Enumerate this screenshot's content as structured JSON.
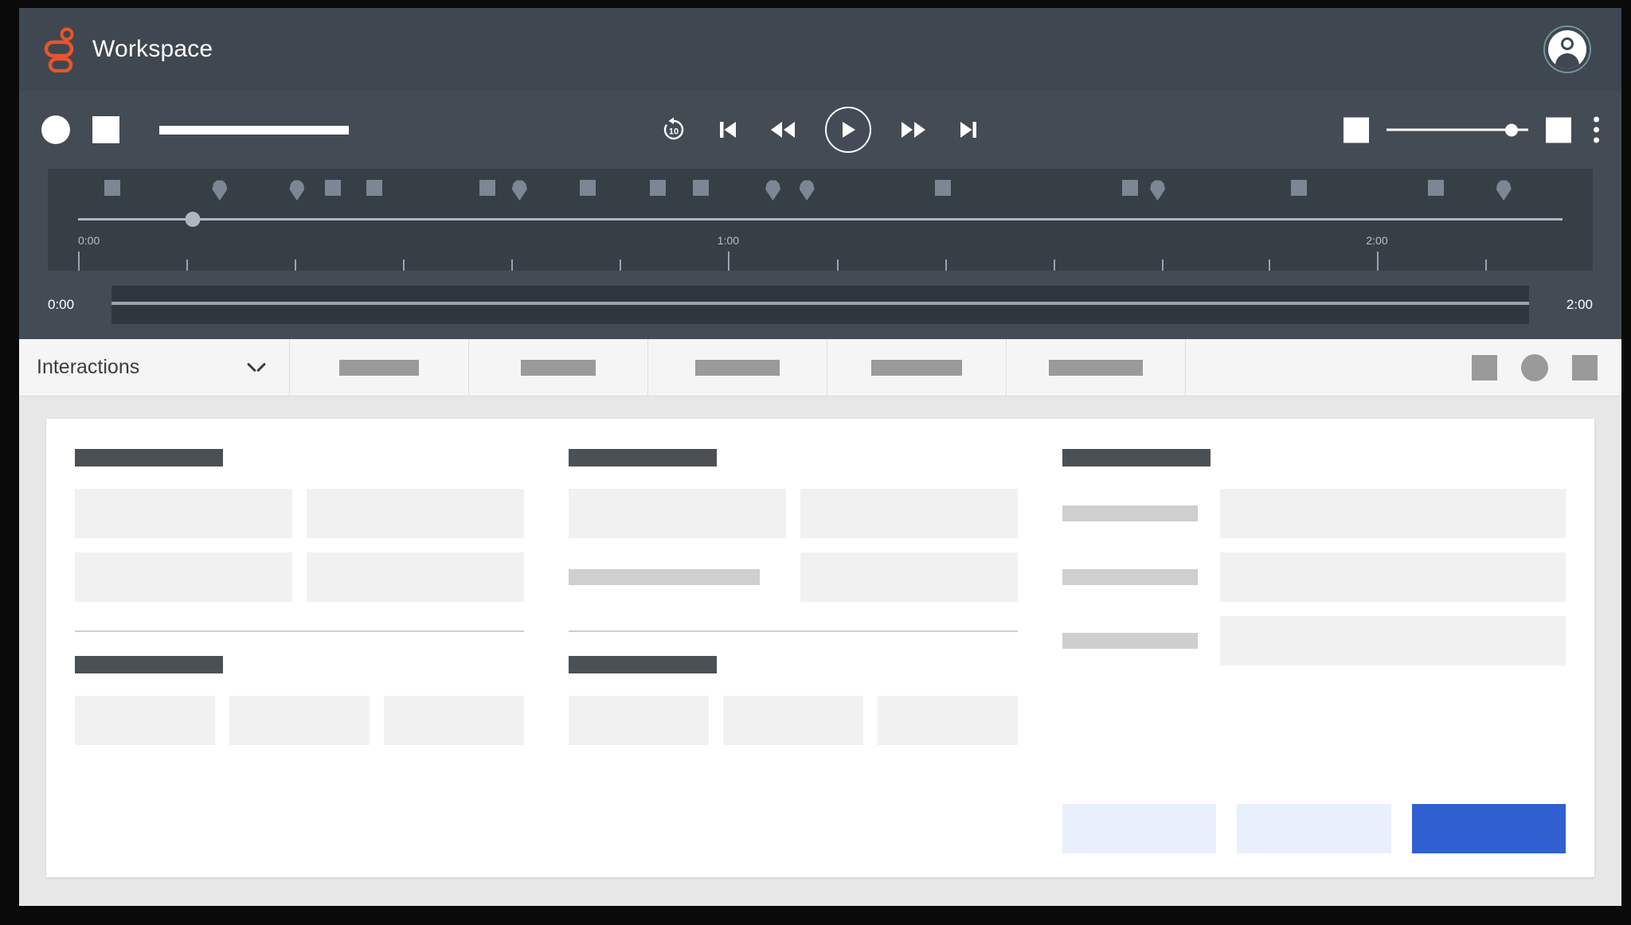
{
  "window": {
    "frame_color": "#0a0a0a",
    "background": "#e7e7e7"
  },
  "header": {
    "title": "Workspace",
    "background": "#3f4750",
    "logo": {
      "icon": "workspace-logo-icon",
      "color": "#e8552c"
    },
    "avatar": {
      "icon": "user-avatar-icon",
      "ring_color": "#6f93a0"
    }
  },
  "player": {
    "background": "#434c55",
    "left_controls": [
      {
        "icon": "record-circle-placeholder",
        "shape": "circle"
      },
      {
        "icon": "stop-square-placeholder",
        "shape": "square"
      },
      {
        "icon": "title-bar-placeholder",
        "shape": "bar"
      }
    ],
    "transport": [
      {
        "icon": "replay-10-icon",
        "label": "10"
      },
      {
        "icon": "skip-previous-icon",
        "label": ""
      },
      {
        "icon": "rewind-icon",
        "label": ""
      },
      {
        "icon": "play-icon",
        "label": ""
      },
      {
        "icon": "fast-forward-icon",
        "label": ""
      },
      {
        "icon": "skip-next-icon",
        "label": ""
      }
    ],
    "right_controls": {
      "mute_icon": "volume-square-placeholder",
      "volume_percent": 88,
      "fullscreen_icon": "fullscreen-square-placeholder",
      "overflow_icon": "kebab-menu-icon"
    }
  },
  "timeline": {
    "background": "#363e46",
    "playhead_percent": 7.4,
    "marker_color": "#7b8794",
    "markers": [
      {
        "type": "square",
        "percent": 2.2
      },
      {
        "type": "pin",
        "percent": 9.2
      },
      {
        "type": "pin",
        "percent": 14.2
      },
      {
        "type": "square",
        "percent": 16.5
      },
      {
        "type": "square",
        "percent": 19.2
      },
      {
        "type": "square",
        "percent": 26.5
      },
      {
        "type": "pin",
        "percent": 28.6
      },
      {
        "type": "square",
        "percent": 33.0
      },
      {
        "type": "square",
        "percent": 37.5
      },
      {
        "type": "square",
        "percent": 40.3
      },
      {
        "type": "pin",
        "percent": 45.0
      },
      {
        "type": "pin",
        "percent": 47.2
      },
      {
        "type": "square",
        "percent": 56.0
      },
      {
        "type": "square",
        "percent": 68.1
      },
      {
        "type": "pin",
        "percent": 69.9
      },
      {
        "type": "square",
        "percent": 79.0
      },
      {
        "type": "square",
        "percent": 87.9
      },
      {
        "type": "pin",
        "percent": 92.3
      }
    ],
    "ruler_labels": [
      {
        "text": "0:00",
        "percent": 0
      },
      {
        "text": "1:00",
        "percent": 43.8
      },
      {
        "text": "2:00",
        "percent": 87.5
      }
    ],
    "ticks": [
      {
        "percent": 0,
        "major": true
      },
      {
        "percent": 7.3,
        "major": false
      },
      {
        "percent": 14.6,
        "major": false
      },
      {
        "percent": 21.9,
        "major": false
      },
      {
        "percent": 29.2,
        "major": false
      },
      {
        "percent": 36.5,
        "major": false
      },
      {
        "percent": 43.8,
        "major": true
      },
      {
        "percent": 51.1,
        "major": false
      },
      {
        "percent": 58.4,
        "major": false
      },
      {
        "percent": 65.7,
        "major": false
      },
      {
        "percent": 73.0,
        "major": false
      },
      {
        "percent": 80.2,
        "major": false
      },
      {
        "percent": 87.5,
        "major": true
      },
      {
        "percent": 94.8,
        "major": false
      }
    ]
  },
  "waveform": {
    "start_time": "0:00",
    "end_time": "2:00",
    "track_color": "#2f363e",
    "line_color": "#9aa4ae"
  },
  "tabbar": {
    "background": "#f5f5f5",
    "selector": {
      "label": "Interactions",
      "icon": "chevron-down-icon"
    },
    "tabs": [
      {
        "label": "",
        "placeholder_width": 100
      },
      {
        "label": "",
        "placeholder_width": 94
      },
      {
        "label": "",
        "placeholder_width": 106
      },
      {
        "label": "",
        "placeholder_width": 114
      },
      {
        "label": "",
        "placeholder_width": 118
      }
    ],
    "actions": [
      {
        "icon": "grid-view-icon",
        "shape": "square"
      },
      {
        "icon": "status-dot-icon",
        "shape": "circle"
      },
      {
        "icon": "list-view-icon",
        "shape": "square"
      }
    ]
  },
  "content": {
    "columns": [
      {
        "name": "column-left",
        "sections": [
          {
            "title_width": 186,
            "layout": "grid2",
            "blocks": [
              {
                "width": "100%"
              },
              {
                "width": "100%"
              },
              {
                "width": "100%"
              },
              {
                "width": "100%"
              }
            ]
          },
          {
            "title_width": 186,
            "layout": "grid3",
            "blocks": [
              {
                "width": "100%"
              },
              {
                "width": "100%"
              },
              {
                "width": "100%"
              }
            ]
          }
        ]
      },
      {
        "name": "column-middle",
        "sections": [
          {
            "title_width": 186,
            "layout": "grid2",
            "blocks": [
              {
                "width": "100%"
              },
              {
                "width": "100%"
              },
              {
                "width": "100%",
                "label": true
              },
              {
                "width": "100%"
              }
            ]
          },
          {
            "title_width": 186,
            "layout": "grid3",
            "blocks": [
              {
                "width": "100%"
              },
              {
                "width": "100%"
              },
              {
                "width": "100%"
              }
            ]
          }
        ]
      },
      {
        "name": "column-right",
        "title_width": 186,
        "rows": [
          {
            "label_width": 150,
            "field_width": "100%"
          },
          {
            "label_width": 150,
            "field_width": "100%"
          },
          {
            "label_width": 150,
            "field_width": "100%"
          }
        ],
        "buttons": [
          {
            "name": "secondary-button-1",
            "style": "ghost",
            "color": "#e8f0fb"
          },
          {
            "name": "secondary-button-2",
            "style": "ghost",
            "color": "#e8f0fb"
          },
          {
            "name": "primary-button",
            "style": "primary",
            "color": "#2f5fd1"
          }
        ]
      }
    ]
  }
}
